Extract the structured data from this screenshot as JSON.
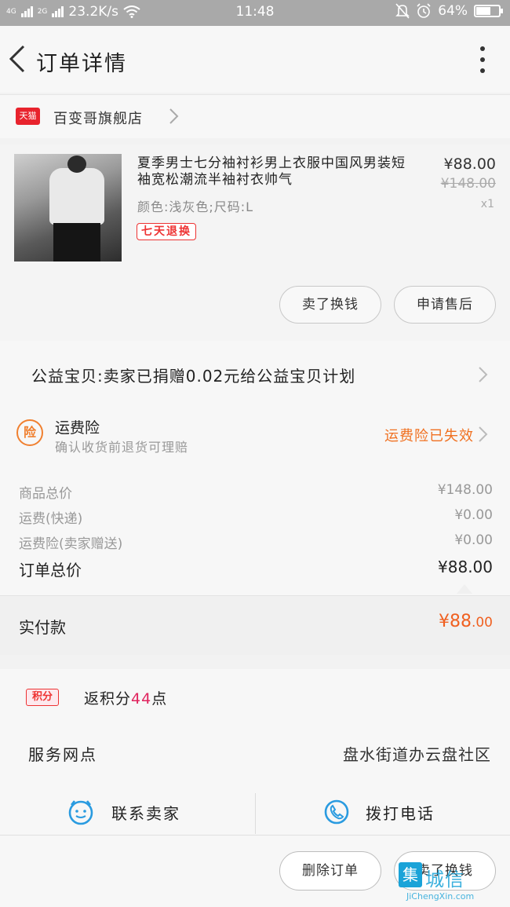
{
  "status_bar": {
    "network_4g": "4G",
    "network_2g": "2G",
    "speed": "23.2K/s",
    "time": "11:48",
    "battery": "64%",
    "battery_level": 0.64
  },
  "header": {
    "title": "订单详情",
    "back_icon": "chevron-left-icon",
    "more_icon": "more-vertical-icon"
  },
  "shop": {
    "badge": "天猫",
    "name": "百变哥旗舰店"
  },
  "product": {
    "title": "夏季男士七分袖衬衫男上衣服中国风男装短袖宽松潮流半袖衬衣帅气",
    "variant": "颜色:浅灰色;尺码:L",
    "tag": "七天退换",
    "price": "¥88.00",
    "original_price": "¥148.00",
    "quantity": "x1",
    "buttons": {
      "sell_for_cash": "卖了换钱",
      "after_sales": "申请售后"
    }
  },
  "charity": {
    "text": "公益宝贝:卖家已捐赠0.02元给公益宝贝计划"
  },
  "insurance": {
    "icon_text": "险",
    "title": "运费险",
    "subtitle": "确认收货前退货可理赔",
    "status": "运费险已失效",
    "status_color": "#f07020"
  },
  "totals": {
    "rows": [
      {
        "label": "商品总价",
        "value": "¥148.00"
      },
      {
        "label": "运费(快递)",
        "value": "¥0.00"
      },
      {
        "label": "运费险(卖家赠送)",
        "value": "¥0.00"
      }
    ],
    "order_total_label": "订单总价",
    "order_total_value": "¥88.00"
  },
  "paid": {
    "label": "实付款",
    "value_major": "¥88",
    "value_minor": ".00",
    "color": "#f06020"
  },
  "points": {
    "badge": "积分",
    "text_before": "返积分",
    "number": "44",
    "text_after": "点"
  },
  "service": {
    "label": "服务网点",
    "value": "盘水街道办云盘社区"
  },
  "contact": {
    "seller_label": "联系卖家",
    "call_label": "拨打电话"
  },
  "footer": {
    "delete_order": "删除订单",
    "sell_for_cash": "卖了换钱"
  },
  "watermark": {
    "logo_char": "集",
    "name": "城信",
    "url": "JiChengXin.com"
  }
}
